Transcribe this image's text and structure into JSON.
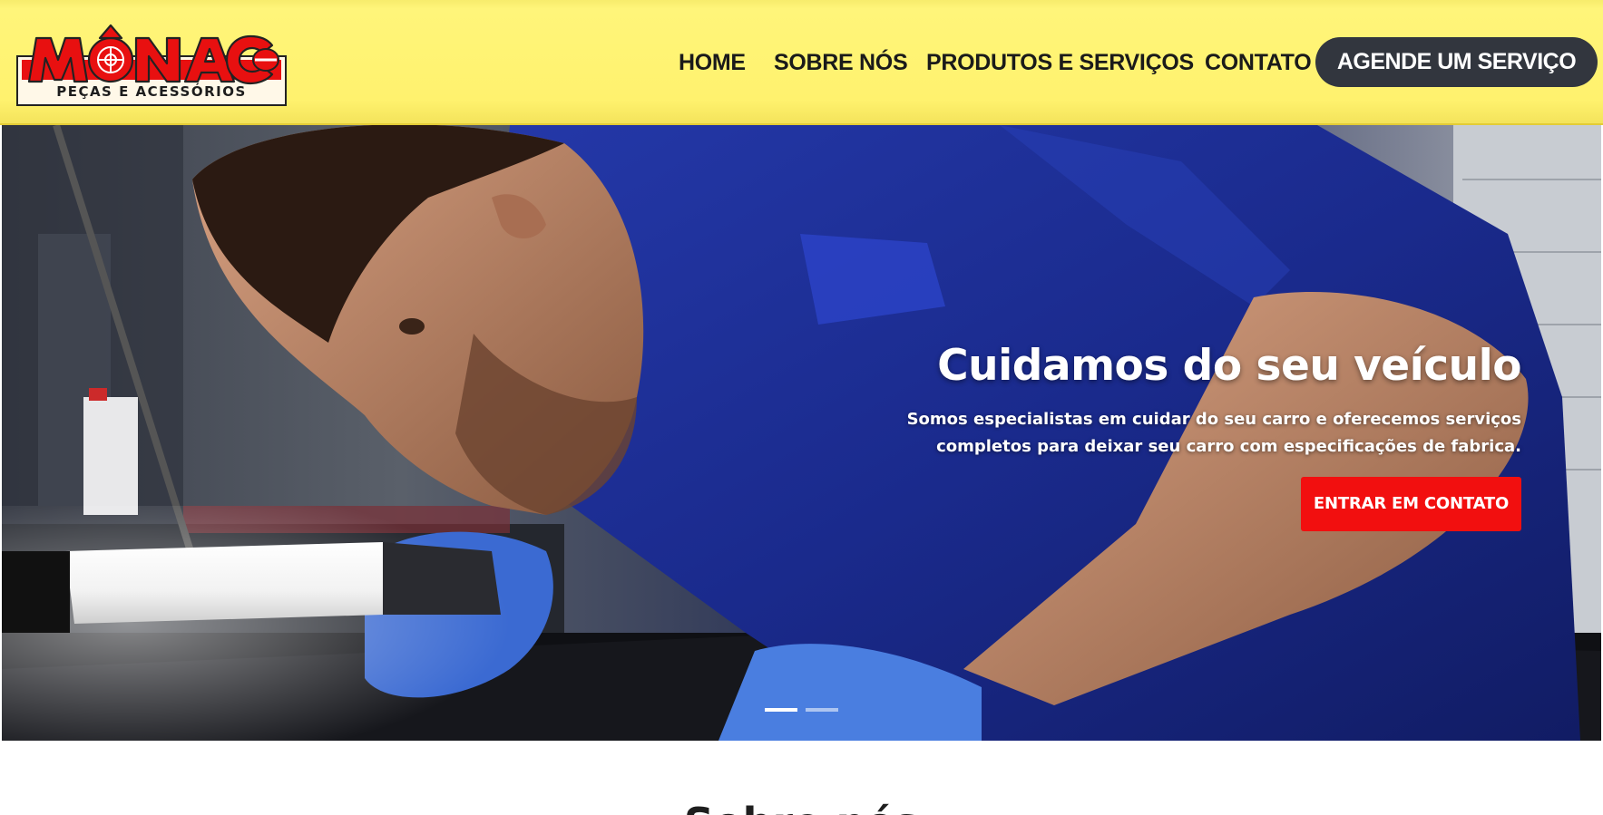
{
  "brand": {
    "name": "MONACO",
    "tagline": "PEÇAS E ACESSÓRIOS",
    "primary_red": "#e81010",
    "header_yellow": "#fff57a"
  },
  "nav": {
    "items": [
      {
        "label": "HOME"
      },
      {
        "label": "SOBRE NÓS"
      },
      {
        "label": "PRODUTOS E SERVIÇOS"
      },
      {
        "label": "CONTATO"
      }
    ],
    "cta_label": "AGENDE UM SERVIÇO",
    "cta_color": "#32363e"
  },
  "hero": {
    "title": "Cuidamos do seu veículo",
    "text_line1": "Somos especialistas em cuidar do seu carro e oferecemos serviços",
    "text_line2": "completos para deixar seu carro com especificações de fabrica.",
    "button_label": "ENTRAR EM CONTATO",
    "button_color": "#f20f0f",
    "slides": [
      {
        "active": true
      },
      {
        "active": false
      }
    ]
  },
  "about": {
    "heading": "Sobre nós"
  }
}
